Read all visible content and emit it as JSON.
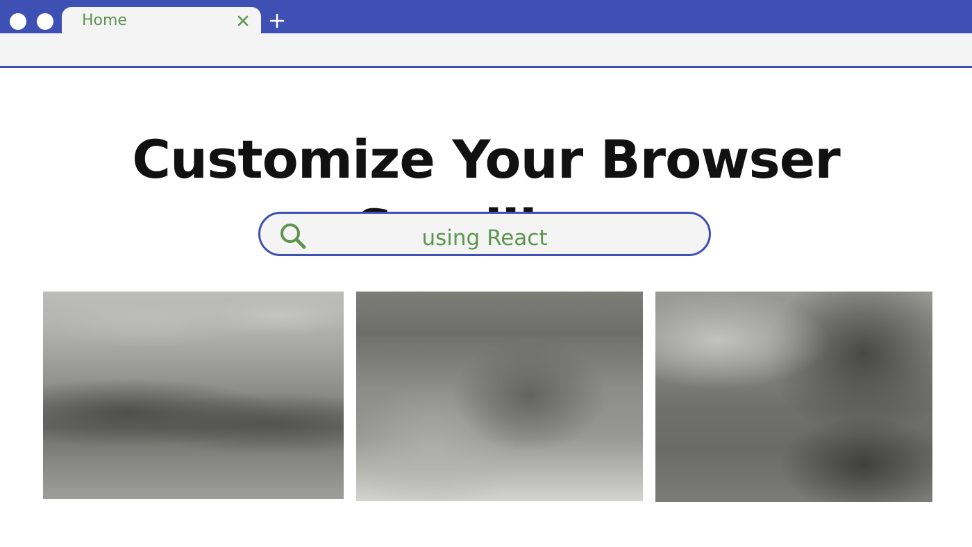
{
  "browser": {
    "tab": {
      "label": "Home",
      "close_icon": "close-icon"
    },
    "new_tab_icon": "plus-icon",
    "window_controls": [
      "circle",
      "circle"
    ]
  },
  "page": {
    "title": "Customize Your Browser Scrollbar",
    "search": {
      "icon": "search-icon",
      "value": "using React"
    },
    "thumbnails": [
      {
        "description": "blurred image"
      },
      {
        "description": "blurred image"
      },
      {
        "description": "blurred image"
      }
    ]
  },
  "colors": {
    "accent": "#3f50b5",
    "green_text": "#5e9450",
    "bar_background": "#f4f4f4"
  }
}
